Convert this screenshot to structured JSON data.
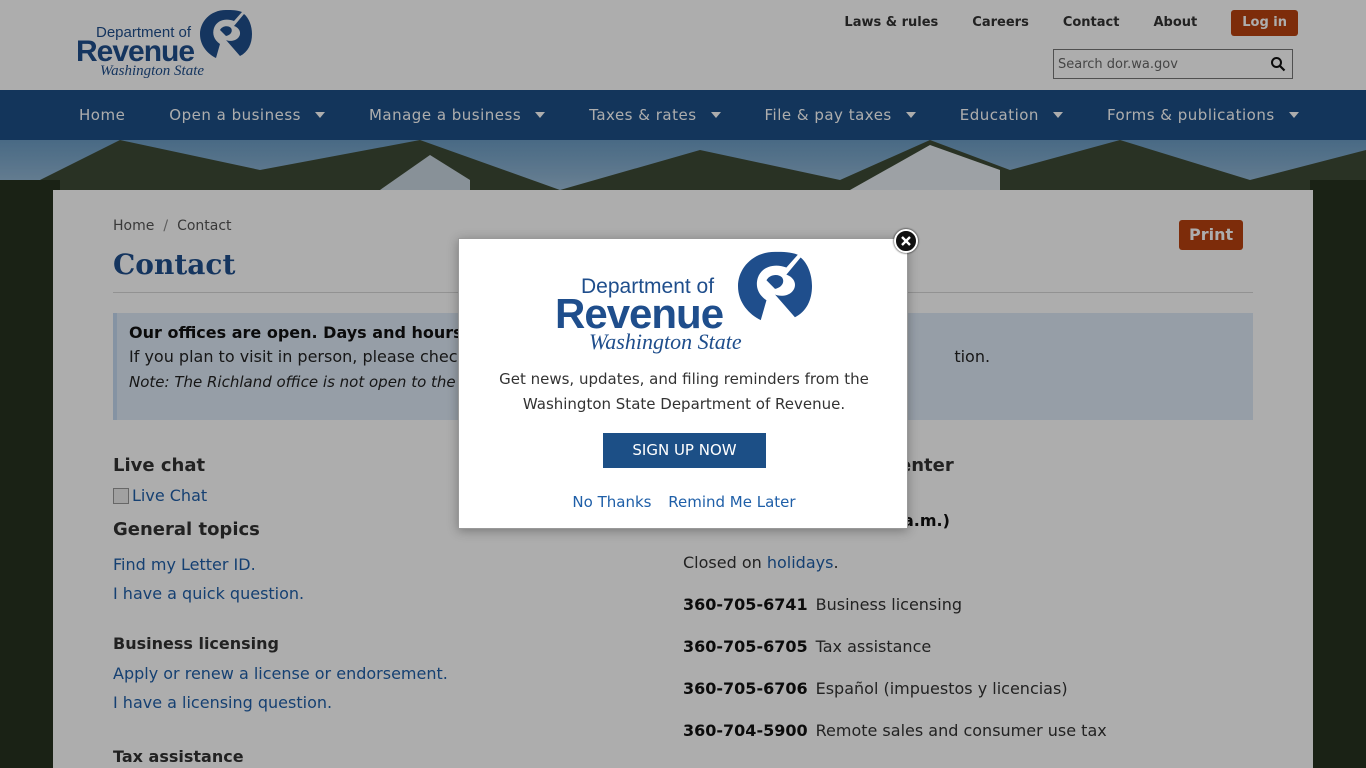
{
  "header": {
    "logo": {
      "line1": "Department of",
      "line2": "Revenue",
      "line3": "Washington State"
    },
    "util_links": [
      "Laws & rules",
      "Careers",
      "Contact",
      "About"
    ],
    "login_label": "Log in",
    "search_placeholder": "Search dor.wa.gov"
  },
  "nav": {
    "items": [
      {
        "label": "Home",
        "has_dropdown": false
      },
      {
        "label": "Open a business",
        "has_dropdown": true
      },
      {
        "label": "Manage a business",
        "has_dropdown": true
      },
      {
        "label": "Taxes & rates",
        "has_dropdown": true
      },
      {
        "label": "File & pay taxes",
        "has_dropdown": true
      },
      {
        "label": "Education",
        "has_dropdown": true
      },
      {
        "label": "Forms & publications",
        "has_dropdown": true
      }
    ]
  },
  "breadcrumb": {
    "home": "Home",
    "separator": "/",
    "current": "Contact"
  },
  "print_label": "Print",
  "page_title": "Contact",
  "notice": {
    "line1": "Our offices are open. Days and hours vary",
    "line2_start": "If you plan to visit in person, please check th",
    "line2_end": "tion.",
    "line3": "Note: The Richland office is not open to the publ"
  },
  "left": {
    "live_chat_heading": "Live chat",
    "live_chat_img_alt": "Live Chat",
    "general_heading": "General topics",
    "general_links": [
      "Find my Letter ID.",
      "I have a quick question."
    ],
    "licensing_heading": "Business licensing",
    "licensing_links": [
      "Apply or renew a license or endorsement.",
      "I have a licensing question."
    ],
    "tax_heading": "Tax assistance"
  },
  "right": {
    "heading_partial": "enter",
    "hours_partial": "a.m.)",
    "closed_prefix": "Closed on ",
    "closed_link": "holidays",
    "closed_suffix": ".",
    "phones": [
      {
        "number": "360-705-6741",
        "label": "Business licensing"
      },
      {
        "number": "360-705-6705",
        "label": "Tax assistance"
      },
      {
        "number": "360-705-6706",
        "label": "Español (impuestos y licencias)"
      },
      {
        "number": "360-704-5900",
        "label": "Remote sales and consumer use tax"
      }
    ]
  },
  "modal": {
    "logo": {
      "line1": "Department of",
      "line2": "Revenue",
      "line3": "Washington State"
    },
    "message": "Get news, updates, and filing reminders from the Washington State Department of Revenue.",
    "signup_label": "SIGN UP NOW",
    "no_thanks": "No Thanks",
    "remind_later": "Remind Me Later"
  },
  "colors": {
    "brand_blue": "#1c4f86",
    "accent_orange": "#b8420f",
    "link_blue": "#1f5fa8",
    "notice_bg": "#dde9f7"
  },
  "icons": {
    "search": "search-icon",
    "close": "close-icon",
    "caret": "caret-down-icon",
    "logo_mark": "dor-logo-icon"
  }
}
